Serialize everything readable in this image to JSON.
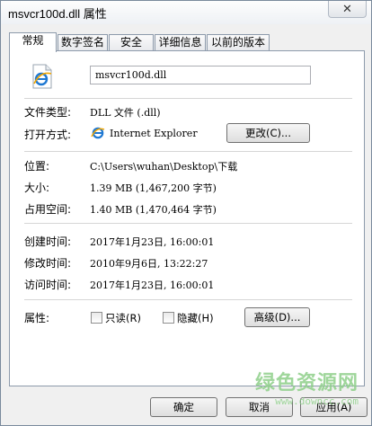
{
  "window": {
    "title": "msvcr100d.dll 属性",
    "close_glyph": "✕"
  },
  "tabs": [
    {
      "label": "常规",
      "active": true
    },
    {
      "label": "数字签名",
      "active": false
    },
    {
      "label": "安全",
      "active": false
    },
    {
      "label": "详细信息",
      "active": false
    },
    {
      "label": "以前的版本",
      "active": false
    }
  ],
  "general": {
    "file_icon": "ie-file-icon",
    "filename": "msvcr100d.dll",
    "file_type_label": "文件类型:",
    "file_type_value": "DLL 文件 (.dll)",
    "opens_with_label": "打开方式:",
    "opens_with_value": "Internet Explorer",
    "change_button": "更改(C)...",
    "location_label": "位置:",
    "location_value": "C:\\Users\\wuhan\\Desktop\\下载",
    "size_label": "大小:",
    "size_value": "1.39 MB (1,467,200 字节)",
    "size_on_disk_label": "占用空间:",
    "size_on_disk_value": "1.40 MB (1,470,464 字节)",
    "created_label": "创建时间:",
    "created_value": "2017年1月23日, 16:00:01",
    "modified_label": "修改时间:",
    "modified_value": "2010年9月6日, 13:22:27",
    "accessed_label": "访问时间:",
    "accessed_value": "2017年1月23日, 16:00:01",
    "attributes_label": "属性:",
    "readonly_label": "只读(R)",
    "readonly_checked": false,
    "hidden_label": "隐藏(H)",
    "hidden_checked": false,
    "advanced_button": "高级(D)..."
  },
  "footer": {
    "ok_button": "确定",
    "cancel_button": "取消",
    "apply_button": "应用(A)"
  },
  "watermark": {
    "text": "绿色资源网",
    "url": "www.downcc.com"
  },
  "colors": {
    "ie_blue": "#1e78d2",
    "ie_orange": "#f2a600",
    "watermark": "#8fd08a"
  }
}
